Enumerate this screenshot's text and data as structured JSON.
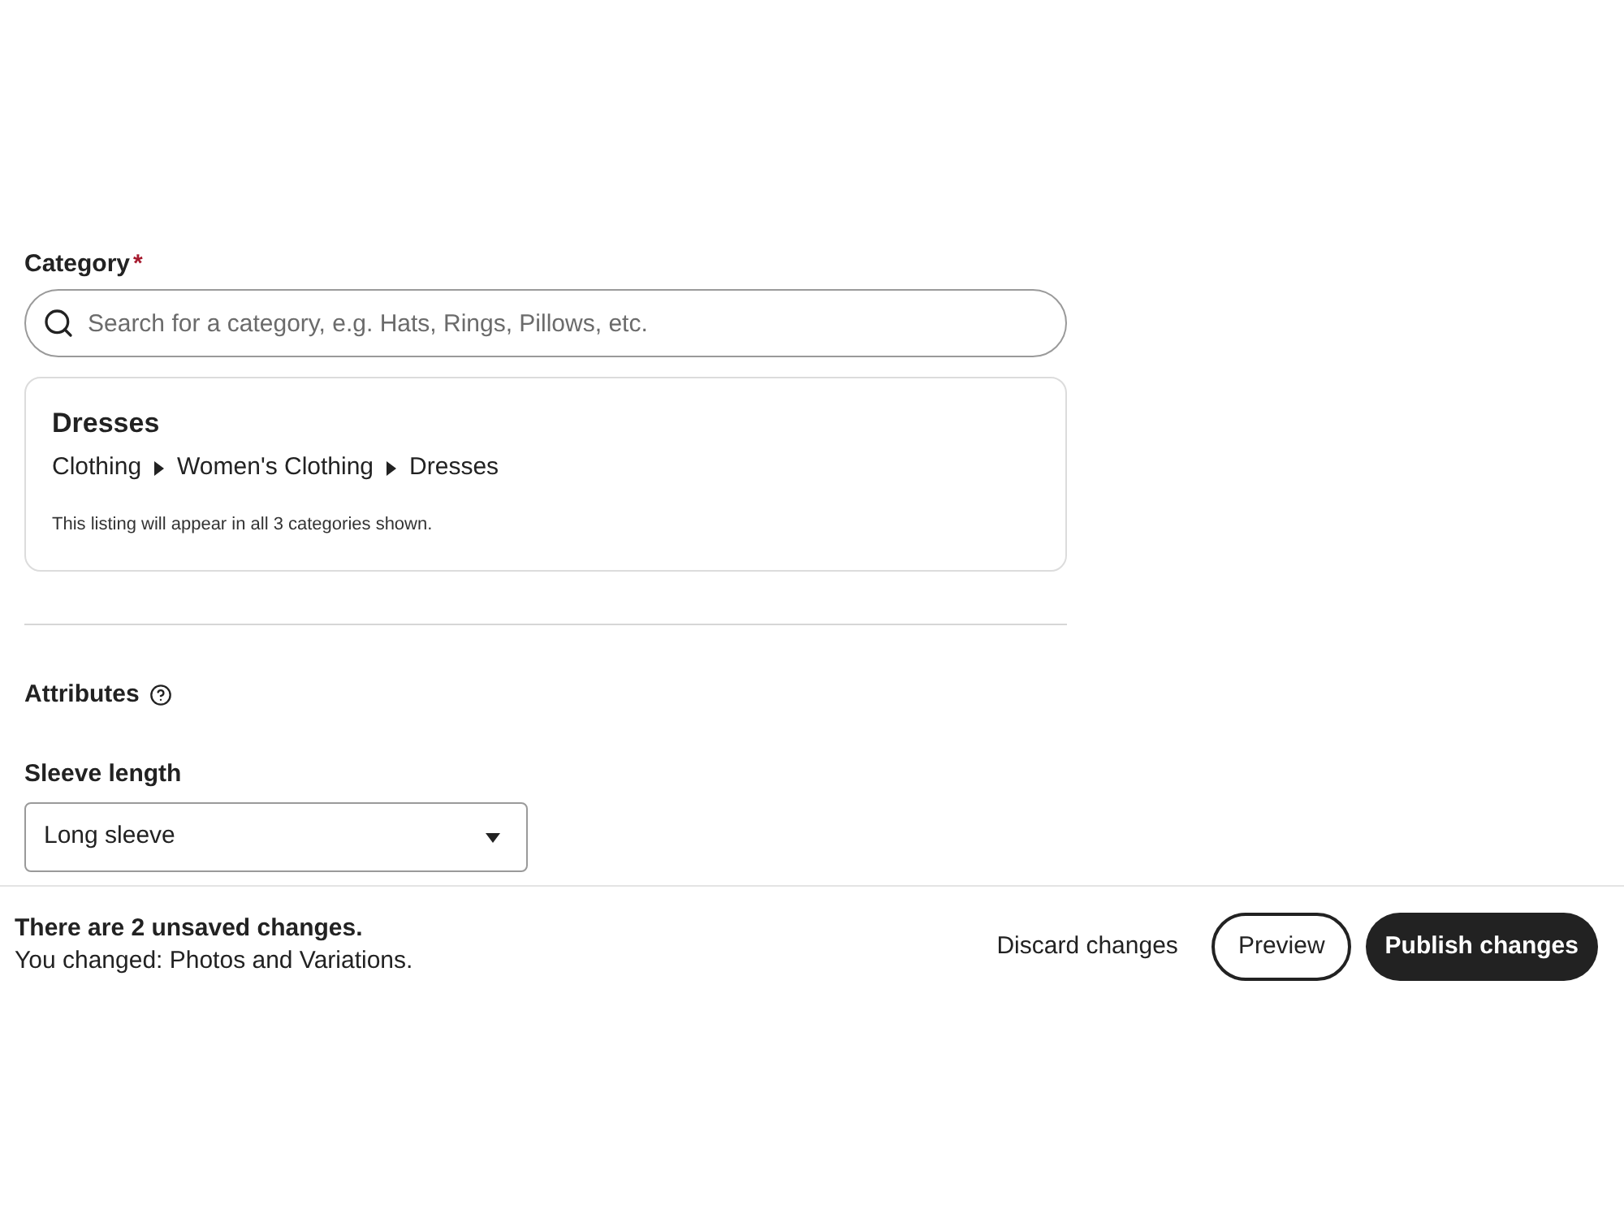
{
  "category": {
    "label": "Category",
    "required_mark": "*",
    "search": {
      "placeholder": "Search for a category, e.g. Hats, Rings, Pillows, etc."
    },
    "selection": {
      "title": "Dresses",
      "path": [
        "Clothing",
        "Women's Clothing",
        "Dresses"
      ],
      "note": "This listing will appear in all 3 categories shown."
    }
  },
  "attributes": {
    "title": "Attributes",
    "fields": [
      {
        "label": "Sleeve length",
        "value": "Long sleeve"
      }
    ]
  },
  "save_bar": {
    "message": "There are 2 unsaved changes.",
    "detail": "You changed: Photos and Variations.",
    "buttons": [
      {
        "label": "Discard changes",
        "kind": "text"
      },
      {
        "label": "Preview",
        "kind": "outline"
      },
      {
        "label": "Publish changes",
        "kind": "primary"
      }
    ]
  }
}
